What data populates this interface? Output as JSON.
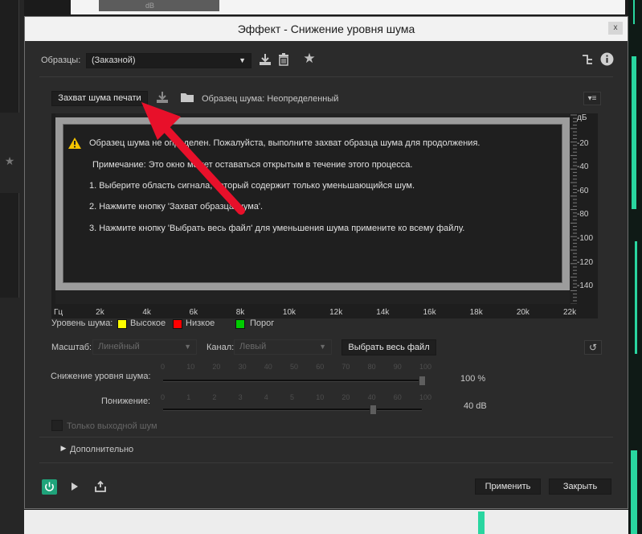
{
  "background": {
    "mini_text": "dB"
  },
  "dialog": {
    "title": "Эффект - Снижение уровня шума",
    "close_glyph": "x"
  },
  "presets": {
    "label": "Образцы:",
    "value": "(Заказной)"
  },
  "capture": {
    "button_label": "Захват шума печати",
    "status": "Образец шума: Неопределенный"
  },
  "message": {
    "warning": "Образец шума не определен. Пожалуйста, выполните захват образца шума для  продолжения.",
    "note": "Примечание: Это окно может оставаться открытым в течение этого процесса.",
    "step1": "1. Выберите область сигнала, который содержит только уменьшающийся шум.",
    "step2": "2. Нажмите кнопку 'Захват образца шума'.",
    "step3": "3. Нажмите кнопку 'Выбрать весь файл' для уменьшения шума примените ко всему файлу."
  },
  "chart_data": {
    "type": "area",
    "x_tick_labels": [
      "Гц",
      "2k",
      "4k",
      "6k",
      "8k",
      "10k",
      "12k",
      "14k",
      "16k",
      "18k",
      "20k",
      "22k"
    ],
    "y_tick_labels": [
      "дБ",
      "-20",
      "-40",
      "-60",
      "-80",
      "-100",
      "-120",
      "-140"
    ],
    "xlim": [
      0,
      22000
    ],
    "ylim": [
      -140,
      0
    ],
    "series": []
  },
  "legend": {
    "label": "Уровень шума:",
    "items": [
      {
        "label": "Высокое",
        "color": "#ffff00"
      },
      {
        "label": "Низкое",
        "color": "#ff0000"
      },
      {
        "label": "Порог",
        "color": "#00cc00"
      }
    ]
  },
  "controls": {
    "scale_label": "Масштаб:",
    "scale_value": "Линейный",
    "channel_label": "Канал:",
    "channel_value": "Левый",
    "select_all_button": "Выбрать весь файл"
  },
  "sliders": {
    "reduction_label": "Снижение уровня шума:",
    "reduction_scale": [
      "0",
      "10",
      "20",
      "30",
      "40",
      "50",
      "60",
      "70",
      "80",
      "90",
      "100"
    ],
    "reduction_value": "100 %",
    "reduction_fraction": 1.0,
    "lowering_label": "Понижение:",
    "lowering_scale": [
      "0",
      "1",
      "2",
      "3",
      "4",
      "5",
      "10",
      "20",
      "40",
      "60",
      "100"
    ],
    "lowering_value": "40 dB",
    "lowering_fraction": 0.81
  },
  "options": {
    "output_noise_only": "Только выходной шум",
    "advanced": "Дополнительно"
  },
  "footer": {
    "apply_button": "Применить",
    "close_button": "Закрыть"
  },
  "colors": {
    "accent_power": "#1fa37a",
    "annotation_arrow": "#e8102a"
  }
}
